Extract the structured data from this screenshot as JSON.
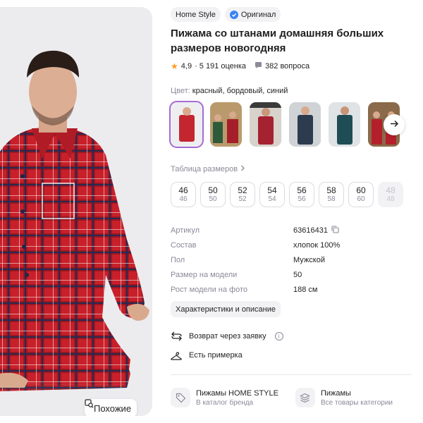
{
  "badges": {
    "brand": "Home Style",
    "original": "Оригинал"
  },
  "product": {
    "title": "Пижама со штанами домашняя больших размеров новогодняя"
  },
  "rating": {
    "score": "4,9",
    "reviews": "· 5 191 оценка",
    "questions": "382 вопроса"
  },
  "color": {
    "label": "Цвет:",
    "value": "красный, бордовый, синий"
  },
  "size_table": {
    "label": "Таблица размеров"
  },
  "sizes": [
    {
      "ru": "46",
      "intl": "46",
      "available": true
    },
    {
      "ru": "50",
      "intl": "50",
      "available": true
    },
    {
      "ru": "52",
      "intl": "52",
      "available": true
    },
    {
      "ru": "54",
      "intl": "54",
      "available": true
    },
    {
      "ru": "56",
      "intl": "56",
      "available": true
    },
    {
      "ru": "58",
      "intl": "58",
      "available": true
    },
    {
      "ru": "60",
      "intl": "60",
      "available": true
    },
    {
      "ru": "48",
      "intl": "48",
      "available": false
    }
  ],
  "specs": [
    {
      "key": "Артикул",
      "value": "63616431"
    },
    {
      "key": "Состав",
      "value": "хлопок 100%"
    },
    {
      "key": "Пол",
      "value": "Мужской"
    },
    {
      "key": "Размер на модели",
      "value": "50"
    },
    {
      "key": "Рост модели на фото",
      "value": "188 см"
    }
  ],
  "details_button": "Характеристики и описание",
  "features": {
    "return": "Возврат через заявку",
    "fitting": "Есть примерка"
  },
  "similar_button": "Похожие",
  "cards": [
    {
      "title": "Пижамы HOME STYLE",
      "subtitle": "В каталог бренда",
      "icon": "tag-icon"
    },
    {
      "title": "Пижамы",
      "subtitle": "Все товары категории",
      "icon": "layers-icon"
    }
  ],
  "colors": {
    "accent": "#a66bd6",
    "star": "#ff9a1f",
    "muted": "#8a8a99",
    "plaid_red": "#c8202a"
  }
}
